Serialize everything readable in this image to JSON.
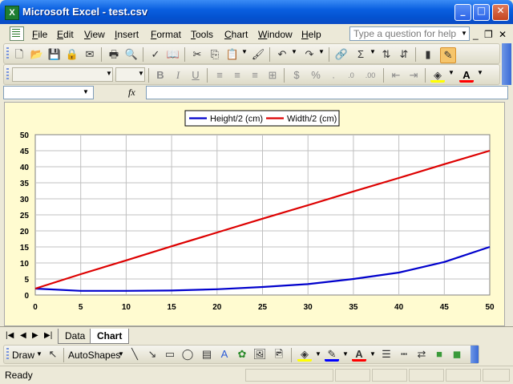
{
  "window": {
    "app_icon": "X",
    "title": "Microsoft Excel - test.csv",
    "minimize_icon": "_",
    "maximize_icon": "□",
    "close_icon": "✕"
  },
  "menu": {
    "items": [
      "File",
      "Edit",
      "View",
      "Insert",
      "Format",
      "Tools",
      "Chart",
      "Window",
      "Help"
    ],
    "help_placeholder": "Type a question for help",
    "mdi_minimize": "_",
    "mdi_restore": "❐",
    "mdi_close": "✕"
  },
  "toolbar_format": {
    "bold": "B",
    "italic": "I",
    "underline": "U",
    "currency": "$",
    "percent": "%",
    "font_color_letter": "A"
  },
  "formula_bar": {
    "fx": "fx"
  },
  "sheet_tabs": [
    "Data",
    "Chart"
  ],
  "active_tab": "Chart",
  "draw_toolbar": {
    "draw": "Draw",
    "autoshapes": "AutoShapes"
  },
  "status": {
    "text": "Ready"
  },
  "colors": {
    "height_series": "#0000cc",
    "width_series": "#dd0000",
    "chart_background": "#fffbd0"
  },
  "chart_data": {
    "type": "line",
    "x": [
      0,
      5,
      10,
      15,
      20,
      25,
      30,
      35,
      40,
      45,
      50
    ],
    "series": [
      {
        "name": "Height/2 (cm)",
        "color": "#0000cc",
        "values": [
          2.0,
          1.3,
          1.3,
          1.4,
          1.8,
          2.5,
          3.4,
          5.0,
          7.0,
          10.3,
          15.0
        ]
      },
      {
        "name": "Width/2 (cm)",
        "color": "#dd0000",
        "values": [
          2.0,
          6.5,
          10.8,
          15.2,
          19.5,
          23.8,
          28.0,
          32.3,
          36.5,
          40.8,
          45.0
        ]
      }
    ],
    "xticks": [
      0,
      5,
      10,
      15,
      20,
      25,
      30,
      35,
      40,
      45,
      50
    ],
    "yticks": [
      0,
      5,
      10,
      15,
      20,
      25,
      30,
      35,
      40,
      45,
      50
    ],
    "xlim": [
      0,
      50
    ],
    "ylim": [
      0,
      50
    ],
    "grid": true,
    "legend": "top"
  }
}
